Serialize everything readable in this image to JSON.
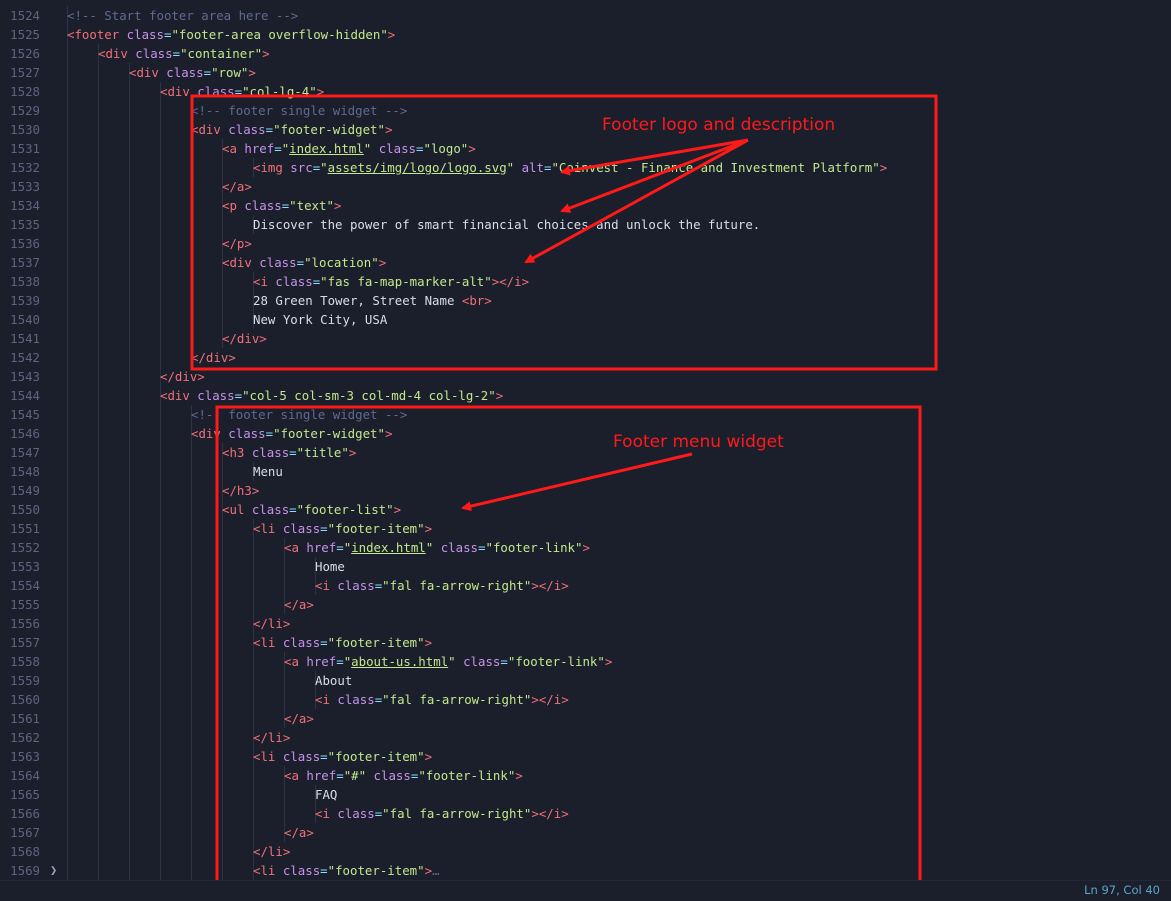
{
  "editor": {
    "lines": [
      {
        "n": "1524",
        "d": 1,
        "t": [
          [
            "com",
            "<!-- Start footer area here -->"
          ]
        ]
      },
      {
        "n": "1525",
        "d": 1,
        "t": [
          [
            "tag",
            "<footer"
          ],
          [
            "attr",
            " class"
          ],
          [
            "eq",
            "="
          ],
          [
            "str",
            "\"footer-area overflow-hidden\""
          ],
          [
            "tag",
            ">"
          ]
        ]
      },
      {
        "n": "1526",
        "d": 2,
        "t": [
          [
            "tag",
            "<div"
          ],
          [
            "attr",
            " class"
          ],
          [
            "eq",
            "="
          ],
          [
            "str",
            "\"container\""
          ],
          [
            "tag",
            ">"
          ]
        ]
      },
      {
        "n": "1527",
        "d": 3,
        "t": [
          [
            "tag",
            "<div"
          ],
          [
            "attr",
            " class"
          ],
          [
            "eq",
            "="
          ],
          [
            "str",
            "\"row\""
          ],
          [
            "tag",
            ">"
          ]
        ]
      },
      {
        "n": "1528",
        "d": 4,
        "t": [
          [
            "tag",
            "<div"
          ],
          [
            "attr",
            " class"
          ],
          [
            "eq",
            "="
          ],
          [
            "str",
            "\"col-lg-4\""
          ],
          [
            "tag",
            ">"
          ]
        ]
      },
      {
        "n": "1529",
        "d": 5,
        "t": [
          [
            "com",
            "<!-- footer single widget -->"
          ]
        ]
      },
      {
        "n": "1530",
        "d": 5,
        "t": [
          [
            "tag",
            "<div"
          ],
          [
            "attr",
            " class"
          ],
          [
            "eq",
            "="
          ],
          [
            "str",
            "\"footer-widget\""
          ],
          [
            "tag",
            ">"
          ]
        ]
      },
      {
        "n": "1531",
        "d": 6,
        "t": [
          [
            "tag",
            "<a"
          ],
          [
            "attr",
            " href"
          ],
          [
            "eq",
            "="
          ],
          [
            "str",
            "\""
          ],
          [
            "strl",
            "index.html"
          ],
          [
            "str",
            "\""
          ],
          [
            "attr",
            " class"
          ],
          [
            "eq",
            "="
          ],
          [
            "str",
            "\"logo\""
          ],
          [
            "tag",
            ">"
          ]
        ]
      },
      {
        "n": "1532",
        "d": 7,
        "t": [
          [
            "tag",
            "<img"
          ],
          [
            "attr",
            " src"
          ],
          [
            "eq",
            "="
          ],
          [
            "str",
            "\""
          ],
          [
            "strl",
            "assets/img/logo/logo.svg"
          ],
          [
            "str",
            "\""
          ],
          [
            "attr",
            " alt"
          ],
          [
            "eq",
            "="
          ],
          [
            "str",
            "\"Coinvest - Finance and Investment Platform\""
          ],
          [
            "tag",
            ">"
          ]
        ]
      },
      {
        "n": "1533",
        "d": 6,
        "t": [
          [
            "tag",
            "</a>"
          ]
        ]
      },
      {
        "n": "1534",
        "d": 6,
        "t": [
          [
            "tag",
            "<p"
          ],
          [
            "attr",
            " class"
          ],
          [
            "eq",
            "="
          ],
          [
            "str",
            "\"text\""
          ],
          [
            "tag",
            ">"
          ]
        ]
      },
      {
        "n": "1535",
        "d": 7,
        "t": [
          [
            "text",
            "Discover the power of smart financial choices and unlock the future."
          ]
        ]
      },
      {
        "n": "1536",
        "d": 6,
        "t": [
          [
            "tag",
            "</p>"
          ]
        ]
      },
      {
        "n": "1537",
        "d": 6,
        "t": [
          [
            "tag",
            "<div"
          ],
          [
            "attr",
            " class"
          ],
          [
            "eq",
            "="
          ],
          [
            "str",
            "\"location\""
          ],
          [
            "tag",
            ">"
          ]
        ]
      },
      {
        "n": "1538",
        "d": 7,
        "t": [
          [
            "tag",
            "<i"
          ],
          [
            "attr",
            " class"
          ],
          [
            "eq",
            "="
          ],
          [
            "str",
            "\"fas fa-map-marker-alt\""
          ],
          [
            "tag",
            "></i>"
          ]
        ]
      },
      {
        "n": "1539",
        "d": 7,
        "t": [
          [
            "text",
            "28 Green Tower, Street Name "
          ],
          [
            "tag",
            "<br>"
          ]
        ]
      },
      {
        "n": "1540",
        "d": 7,
        "t": [
          [
            "text",
            "New York City, USA"
          ]
        ]
      },
      {
        "n": "1541",
        "d": 6,
        "t": [
          [
            "tag",
            "</div>"
          ]
        ]
      },
      {
        "n": "1542",
        "d": 5,
        "t": [
          [
            "tag",
            "</div>"
          ]
        ]
      },
      {
        "n": "1543",
        "d": 4,
        "t": [
          [
            "tag",
            "</div>"
          ]
        ]
      },
      {
        "n": "1544",
        "d": 4,
        "t": [
          [
            "tag",
            "<div"
          ],
          [
            "attr",
            " class"
          ],
          [
            "eq",
            "="
          ],
          [
            "str",
            "\"col-5 col-sm-3 col-md-4 col-lg-2\""
          ],
          [
            "tag",
            ">"
          ]
        ]
      },
      {
        "n": "1545",
        "d": 5,
        "t": [
          [
            "com",
            "<!-- footer single widget -->"
          ]
        ]
      },
      {
        "n": "1546",
        "d": 5,
        "t": [
          [
            "tag",
            "<div"
          ],
          [
            "attr",
            " class"
          ],
          [
            "eq",
            "="
          ],
          [
            "str",
            "\"footer-widget\""
          ],
          [
            "tag",
            ">"
          ]
        ]
      },
      {
        "n": "1547",
        "d": 6,
        "t": [
          [
            "tag",
            "<h3"
          ],
          [
            "attr",
            " class"
          ],
          [
            "eq",
            "="
          ],
          [
            "str",
            "\"title\""
          ],
          [
            "tag",
            ">"
          ]
        ]
      },
      {
        "n": "1548",
        "d": 7,
        "t": [
          [
            "text",
            "Menu"
          ]
        ]
      },
      {
        "n": "1549",
        "d": 6,
        "t": [
          [
            "tag",
            "</h3>"
          ]
        ]
      },
      {
        "n": "1550",
        "d": 6,
        "t": [
          [
            "tag",
            "<ul"
          ],
          [
            "attr",
            " class"
          ],
          [
            "eq",
            "="
          ],
          [
            "str",
            "\"footer-list\""
          ],
          [
            "tag",
            ">"
          ]
        ]
      },
      {
        "n": "1551",
        "d": 7,
        "t": [
          [
            "tag",
            "<li"
          ],
          [
            "attr",
            " class"
          ],
          [
            "eq",
            "="
          ],
          [
            "str",
            "\"footer-item\""
          ],
          [
            "tag",
            ">"
          ]
        ]
      },
      {
        "n": "1552",
        "d": 8,
        "t": [
          [
            "tag",
            "<a"
          ],
          [
            "attr",
            " href"
          ],
          [
            "eq",
            "="
          ],
          [
            "str",
            "\""
          ],
          [
            "strl",
            "index.html"
          ],
          [
            "str",
            "\""
          ],
          [
            "attr",
            " class"
          ],
          [
            "eq",
            "="
          ],
          [
            "str",
            "\"footer-link\""
          ],
          [
            "tag",
            ">"
          ]
        ]
      },
      {
        "n": "1553",
        "d": 9,
        "t": [
          [
            "text",
            "Home"
          ]
        ]
      },
      {
        "n": "1554",
        "d": 9,
        "t": [
          [
            "tag",
            "<i"
          ],
          [
            "attr",
            " class"
          ],
          [
            "eq",
            "="
          ],
          [
            "str",
            "\"fal fa-arrow-right\""
          ],
          [
            "tag",
            "></i>"
          ]
        ]
      },
      {
        "n": "1555",
        "d": 8,
        "t": [
          [
            "tag",
            "</a>"
          ]
        ]
      },
      {
        "n": "1556",
        "d": 7,
        "t": [
          [
            "tag",
            "</li>"
          ]
        ]
      },
      {
        "n": "1557",
        "d": 7,
        "t": [
          [
            "tag",
            "<li"
          ],
          [
            "attr",
            " class"
          ],
          [
            "eq",
            "="
          ],
          [
            "str",
            "\"footer-item\""
          ],
          [
            "tag",
            ">"
          ]
        ]
      },
      {
        "n": "1558",
        "d": 8,
        "t": [
          [
            "tag",
            "<a"
          ],
          [
            "attr",
            " href"
          ],
          [
            "eq",
            "="
          ],
          [
            "str",
            "\""
          ],
          [
            "strl",
            "about-us.html"
          ],
          [
            "str",
            "\""
          ],
          [
            "attr",
            " class"
          ],
          [
            "eq",
            "="
          ],
          [
            "str",
            "\"footer-link\""
          ],
          [
            "tag",
            ">"
          ]
        ]
      },
      {
        "n": "1559",
        "d": 9,
        "t": [
          [
            "text",
            "About"
          ]
        ]
      },
      {
        "n": "1560",
        "d": 9,
        "t": [
          [
            "tag",
            "<i"
          ],
          [
            "attr",
            " class"
          ],
          [
            "eq",
            "="
          ],
          [
            "str",
            "\"fal fa-arrow-right\""
          ],
          [
            "tag",
            "></i>"
          ]
        ]
      },
      {
        "n": "1561",
        "d": 8,
        "t": [
          [
            "tag",
            "</a>"
          ]
        ]
      },
      {
        "n": "1562",
        "d": 7,
        "t": [
          [
            "tag",
            "</li>"
          ]
        ]
      },
      {
        "n": "1563",
        "d": 7,
        "t": [
          [
            "tag",
            "<li"
          ],
          [
            "attr",
            " class"
          ],
          [
            "eq",
            "="
          ],
          [
            "str",
            "\"footer-item\""
          ],
          [
            "tag",
            ">"
          ]
        ]
      },
      {
        "n": "1564",
        "d": 8,
        "t": [
          [
            "tag",
            "<a"
          ],
          [
            "attr",
            " href"
          ],
          [
            "eq",
            "="
          ],
          [
            "str",
            "\"#\""
          ],
          [
            "attr",
            " class"
          ],
          [
            "eq",
            "="
          ],
          [
            "str",
            "\"footer-link\""
          ],
          [
            "tag",
            ">"
          ]
        ]
      },
      {
        "n": "1565",
        "d": 9,
        "t": [
          [
            "text",
            "FAQ"
          ]
        ]
      },
      {
        "n": "1566",
        "d": 9,
        "t": [
          [
            "tag",
            "<i"
          ],
          [
            "attr",
            " class"
          ],
          [
            "eq",
            "="
          ],
          [
            "str",
            "\"fal fa-arrow-right\""
          ],
          [
            "tag",
            "></i>"
          ]
        ]
      },
      {
        "n": "1567",
        "d": 8,
        "t": [
          [
            "tag",
            "</a>"
          ]
        ]
      },
      {
        "n": "1568",
        "d": 7,
        "t": [
          [
            "tag",
            "</li>"
          ]
        ]
      },
      {
        "n": "1569",
        "d": 7,
        "fold": true,
        "t": [
          [
            "tag",
            "<li"
          ],
          [
            "attr",
            " class"
          ],
          [
            "eq",
            "="
          ],
          [
            "str",
            "\"footer-item\""
          ],
          [
            "tag",
            ">"
          ],
          [
            "com",
            "…"
          ]
        ]
      }
    ]
  },
  "annotations": {
    "logo_label": "Footer logo and description",
    "menu_label": "Footer menu widget",
    "color": "#ff1a1a"
  },
  "status": {
    "position": "Ln 97, Col 40"
  }
}
